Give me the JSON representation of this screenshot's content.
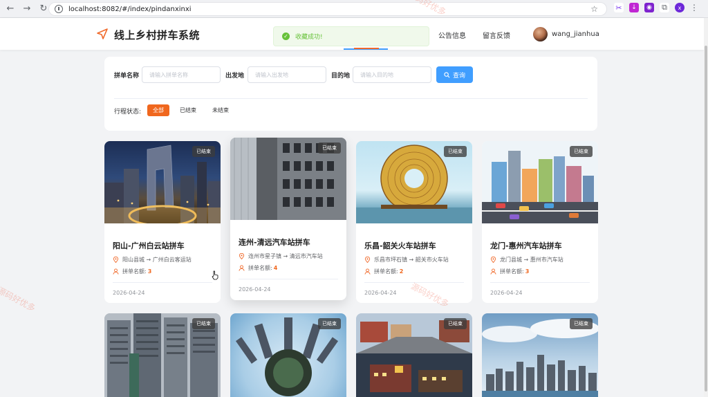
{
  "browser": {
    "url": "localhost:8082/#/index/pindanxinxi",
    "profile_initial": "x"
  },
  "header": {
    "title": "线上乡村拼车系统",
    "nav": [
      "公告信息",
      "留言反馈"
    ],
    "username": "wang_jianhua",
    "accent": "#f06a2b"
  },
  "toast": {
    "message": "收藏成功!"
  },
  "search": {
    "labels": [
      "拼单名称",
      "出发地",
      "目的地"
    ],
    "placeholders": [
      "请输入拼单名称",
      "请输入出发地",
      "请输入目的地"
    ],
    "button": "查询",
    "status_label": "行程状态:",
    "status_options": [
      "全部",
      "已结束",
      "未结束"
    ],
    "active_status": "全部"
  },
  "cards": [
    {
      "badge": "已结束",
      "title": "阳山-广州白云站拼车",
      "route": "阳山县城 → 广州白云客运站",
      "seats_label": "拼单名额:",
      "seats": "3",
      "date": "2026-04-24",
      "image": "cctv-tower-night"
    },
    {
      "badge": "已结束",
      "title": "连州-清远汽车站拼车",
      "route": "连州市星子镇 → 清远市汽车站",
      "seats_label": "拼单名额:",
      "seats": "4",
      "date": "2026-04-24",
      "image": "building-facade"
    },
    {
      "badge": "已结束",
      "title": "乐昌-韶关火车站拼车",
      "route": "乐昌市坪石镇 → 韶关市火车站",
      "seats_label": "拼单名额:",
      "seats": "2",
      "date": "2026-04-24",
      "image": "ring-building"
    },
    {
      "badge": "已结束",
      "title": "龙门-惠州汽车站拼车",
      "route": "龙门县城 → 惠州市汽车站",
      "seats_label": "拼单名额:",
      "seats": "3",
      "date": "2026-04-24",
      "image": "cartoon-city"
    },
    {
      "badge": "已结束",
      "image": "high-rise-apartments"
    },
    {
      "badge": "已结束",
      "image": "tiny-planet-city"
    },
    {
      "badge": "已结束",
      "image": "street-town"
    },
    {
      "badge": "已结束",
      "image": "skyline-clouds"
    }
  ],
  "watermark": "源码好优多"
}
